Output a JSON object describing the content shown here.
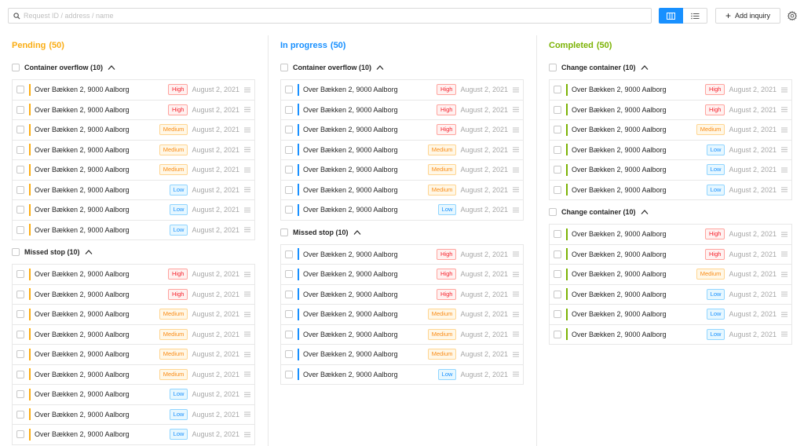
{
  "search": {
    "placeholder": "Request ID / address / name"
  },
  "toolbar": {
    "add_label": "Add inquiry"
  },
  "colors": {
    "pending": "#faad14",
    "in_progress": "#1890ff",
    "completed": "#7cb305"
  },
  "columns": [
    {
      "title": "Pending",
      "count": "(50)",
      "groups": [
        {
          "title": "Container overflow (10)",
          "rows": [
            {
              "address": "Over Bækken 2, 9000 Aalborg",
              "priority": "High",
              "date": "August 2, 2021"
            },
            {
              "address": "Over Bækken 2, 9000 Aalborg",
              "priority": "High",
              "date": "August 2, 2021"
            },
            {
              "address": "Over Bækken 2, 9000 Aalborg",
              "priority": "Medium",
              "date": "August 2, 2021"
            },
            {
              "address": "Over Bækken 2, 9000 Aalborg",
              "priority": "Medium",
              "date": "August 2, 2021"
            },
            {
              "address": "Over Bækken 2, 9000 Aalborg",
              "priority": "Medium",
              "date": "August 2, 2021"
            },
            {
              "address": "Over Bækken 2, 9000 Aalborg",
              "priority": "Low",
              "date": "August 2, 2021"
            },
            {
              "address": "Over Bækken 2, 9000 Aalborg",
              "priority": "Low",
              "date": "August 2, 2021"
            },
            {
              "address": "Over Bækken 2, 9000 Aalborg",
              "priority": "Low",
              "date": "August 2, 2021"
            }
          ]
        },
        {
          "title": "Missed stop (10)",
          "rows": [
            {
              "address": "Over Bækken 2, 9000 Aalborg",
              "priority": "High",
              "date": "August 2, 2021"
            },
            {
              "address": "Over Bækken 2, 9000 Aalborg",
              "priority": "High",
              "date": "August 2, 2021"
            },
            {
              "address": "Over Bækken 2, 9000 Aalborg",
              "priority": "Medium",
              "date": "August 2, 2021"
            },
            {
              "address": "Over Bækken 2, 9000 Aalborg",
              "priority": "Medium",
              "date": "August 2, 2021"
            },
            {
              "address": "Over Bækken 2, 9000 Aalborg",
              "priority": "Medium",
              "date": "August 2, 2021"
            },
            {
              "address": "Over Bækken 2, 9000 Aalborg",
              "priority": "Medium",
              "date": "August 2, 2021"
            },
            {
              "address": "Over Bækken 2, 9000 Aalborg",
              "priority": "Low",
              "date": "August 2, 2021"
            },
            {
              "address": "Over Bækken 2, 9000 Aalborg",
              "priority": "Low",
              "date": "August 2, 2021"
            },
            {
              "address": "Over Bækken 2, 9000 Aalborg",
              "priority": "Low",
              "date": "August 2, 2021"
            }
          ]
        }
      ]
    },
    {
      "title": "In progress",
      "count": "(50)",
      "groups": [
        {
          "title": "Container overflow (10)",
          "rows": [
            {
              "address": "Over Bækken 2, 9000 Aalborg",
              "priority": "High",
              "date": "August 2, 2021"
            },
            {
              "address": "Over Bækken 2, 9000 Aalborg",
              "priority": "High",
              "date": "August 2, 2021"
            },
            {
              "address": "Over Bækken 2, 9000 Aalborg",
              "priority": "High",
              "date": "August 2, 2021"
            },
            {
              "address": "Over Bækken 2, 9000 Aalborg",
              "priority": "Medium",
              "date": "August 2, 2021"
            },
            {
              "address": "Over Bækken 2, 9000 Aalborg",
              "priority": "Medium",
              "date": "August 2, 2021"
            },
            {
              "address": "Over Bækken 2, 9000 Aalborg",
              "priority": "Medium",
              "date": "August 2, 2021"
            },
            {
              "address": "Over Bækken 2, 9000 Aalborg",
              "priority": "Low",
              "date": "August 2, 2021"
            }
          ]
        },
        {
          "title": "Missed stop (10)",
          "rows": [
            {
              "address": "Over Bækken 2, 9000 Aalborg",
              "priority": "High",
              "date": "August 2, 2021"
            },
            {
              "address": "Over Bækken 2, 9000 Aalborg",
              "priority": "High",
              "date": "August 2, 2021"
            },
            {
              "address": "Over Bækken 2, 9000 Aalborg",
              "priority": "High",
              "date": "August 2, 2021"
            },
            {
              "address": "Over Bækken 2, 9000 Aalborg",
              "priority": "Medium",
              "date": "August 2, 2021"
            },
            {
              "address": "Over Bækken 2, 9000 Aalborg",
              "priority": "Medium",
              "date": "August 2, 2021"
            },
            {
              "address": "Over Bækken 2, 9000 Aalborg",
              "priority": "Medium",
              "date": "August 2, 2021"
            },
            {
              "address": "Over Bækken 2, 9000 Aalborg",
              "priority": "Low",
              "date": "August 2, 2021"
            }
          ]
        }
      ]
    },
    {
      "title": "Completed",
      "count": "(50)",
      "groups": [
        {
          "title": "Change container (10)",
          "rows": [
            {
              "address": "Over Bækken 2, 9000 Aalborg",
              "priority": "High",
              "date": "August 2, 2021"
            },
            {
              "address": "Over Bækken 2, 9000 Aalborg",
              "priority": "High",
              "date": "August 2, 2021"
            },
            {
              "address": "Over Bækken 2, 9000 Aalborg",
              "priority": "Medium",
              "date": "August 2, 2021"
            },
            {
              "address": "Over Bækken 2, 9000 Aalborg",
              "priority": "Low",
              "date": "August 2, 2021"
            },
            {
              "address": "Over Bækken 2, 9000 Aalborg",
              "priority": "Low",
              "date": "August 2, 2021"
            },
            {
              "address": "Over Bækken 2, 9000 Aalborg",
              "priority": "Low",
              "date": "August 2, 2021"
            }
          ]
        },
        {
          "title": "Change container (10)",
          "rows": [
            {
              "address": "Over Bækken 2, 9000 Aalborg",
              "priority": "High",
              "date": "August 2, 2021"
            },
            {
              "address": "Over Bækken 2, 9000 Aalborg",
              "priority": "High",
              "date": "August 2, 2021"
            },
            {
              "address": "Over Bækken 2, 9000 Aalborg",
              "priority": "Medium",
              "date": "August 2, 2021"
            },
            {
              "address": "Over Bækken 2, 9000 Aalborg",
              "priority": "Low",
              "date": "August 2, 2021"
            },
            {
              "address": "Over Bækken 2, 9000 Aalborg",
              "priority": "Low",
              "date": "August 2, 2021"
            },
            {
              "address": "Over Bækken 2, 9000 Aalborg",
              "priority": "Low",
              "date": "August 2, 2021"
            }
          ]
        }
      ]
    }
  ]
}
